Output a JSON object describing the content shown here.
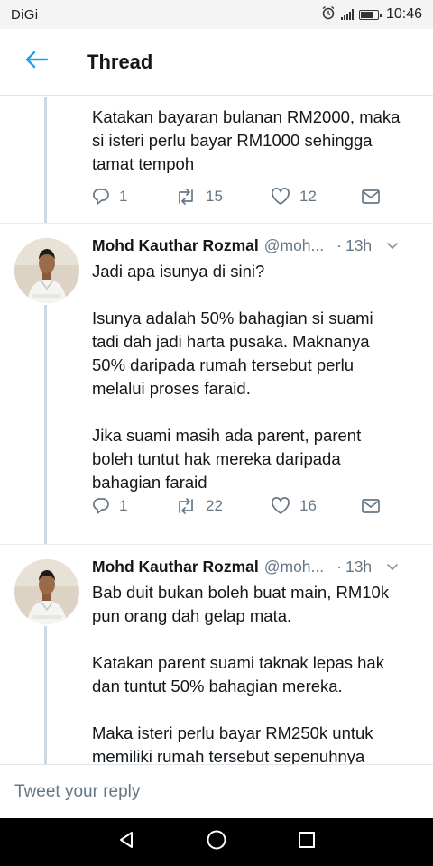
{
  "status_bar": {
    "carrier": "DiGi",
    "time": "10:46",
    "icons": [
      "alarm-icon",
      "signal-icon",
      "battery-icon"
    ]
  },
  "header": {
    "title": "Thread",
    "back_icon": "arrow-left-icon",
    "accent_color": "#1da1f2"
  },
  "tweets": [
    {
      "text": "Katakan bayaran bulanan RM2000, maka\nsi isteri perlu bayar RM1000 sehingga\ntamat tempoh",
      "replies": "1",
      "retweets": "15",
      "likes": "12"
    },
    {
      "name": "Mohd Kauthar Rozmal",
      "handle": "@moh...",
      "dot": "·",
      "time": "13h",
      "text": "Jadi apa isunya di sini?\n\nIsunya adalah 50% bahagian si suami\ntadi dah jadi harta pusaka. Maknanya\n50% daripada rumah tersebut perlu\nmelalui proses faraid.\n\nJika suami masih ada parent, parent\nboleh tuntut hak mereka daripada\nbahagian faraid",
      "replies": "1",
      "retweets": "22",
      "likes": "16"
    },
    {
      "name": "Mohd Kauthar Rozmal",
      "handle": "@moh...",
      "dot": "·",
      "time": "13h",
      "text": "Bab duit bukan boleh buat main, RM10k\npun orang dah gelap mata.\n\nKatakan parent suami taknak lepas hak\ndan tuntut 50% bahagian mereka.\n\nMaka isteri perlu bayar RM250k untuk\nmemiliki rumah tersebut sepenuhnya"
    }
  ],
  "reply_bar": {
    "placeholder": "Tweet your reply"
  },
  "nav_bar": {
    "icons": [
      "back-triangle-icon",
      "home-circle-icon",
      "recents-square-icon"
    ]
  },
  "colors": {
    "text": "#14171a",
    "muted": "#657786",
    "thread_line": "#cdd9e2"
  }
}
